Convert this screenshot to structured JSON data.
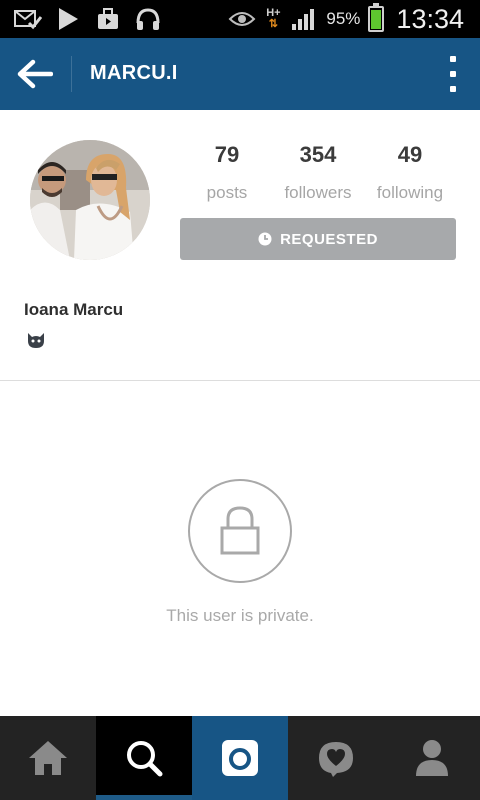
{
  "status_bar": {
    "battery_percent": "95%",
    "time": "13:34",
    "network": "H+",
    "icons": [
      "mail-check-icon",
      "play-store-icon",
      "shopping-bag-icon",
      "headphones-icon",
      "eye-icon",
      "network-icon",
      "signal-icon",
      "battery-icon"
    ]
  },
  "app_bar": {
    "title": "MARCU.I",
    "background": "#175585"
  },
  "profile": {
    "stats": [
      {
        "value": "79",
        "label": "posts"
      },
      {
        "value": "354",
        "label": "followers"
      },
      {
        "value": "49",
        "label": "following"
      }
    ],
    "follow_button_label": "REQUESTED",
    "full_name": "Ioana Marcu",
    "bio_icon": "cat-face-icon"
  },
  "private_notice": {
    "message": "This user is private."
  },
  "bottom_nav": {
    "items": [
      "home",
      "search",
      "camera",
      "activity",
      "profile"
    ],
    "active": "search"
  }
}
